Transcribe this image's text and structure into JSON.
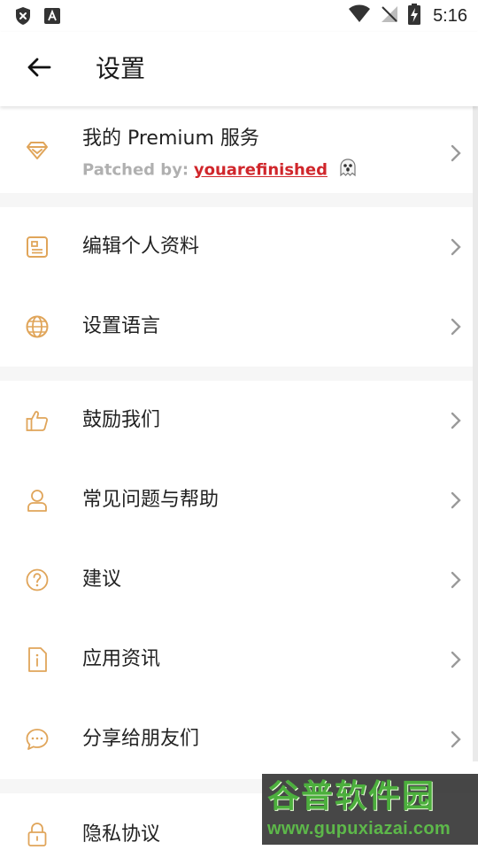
{
  "status_bar": {
    "time": "5:16",
    "left_icons": [
      "shield-x-icon",
      "font-icon"
    ],
    "right_icons": [
      "wifi-icon",
      "no-signal-icon",
      "battery-charging-icon"
    ]
  },
  "app_bar": {
    "title": "设置",
    "back_icon": "arrow-left-icon"
  },
  "premium": {
    "title": "我的 Premium 服务",
    "patched_label": "Patched by:",
    "patched_name": "youarefinished",
    "ghost_icon": "ghost-icon",
    "icon": "diamond-icon"
  },
  "section1": [
    {
      "label": "编辑个人资料",
      "icon": "profile-card-icon"
    },
    {
      "label": "设置语言",
      "icon": "globe-icon"
    }
  ],
  "section2": [
    {
      "label": "鼓励我们",
      "icon": "thumbs-up-icon"
    },
    {
      "label": "常见问题与帮助",
      "icon": "person-icon"
    },
    {
      "label": "建议",
      "icon": "question-icon"
    },
    {
      "label": "应用资讯",
      "icon": "info-document-icon"
    },
    {
      "label": "分享给朋友们",
      "icon": "chat-bubble-icon"
    }
  ],
  "section3": [
    {
      "label": "隐私协议",
      "icon": "lock-icon"
    }
  ],
  "watermark": {
    "title": "谷普软件园",
    "url": "www.gupuxiazai.com"
  },
  "colors": {
    "accent": "#e0a55a",
    "chevron": "#9a9a9a",
    "patched_name": "#d0262b",
    "watermark_green": "#4caf3d"
  }
}
